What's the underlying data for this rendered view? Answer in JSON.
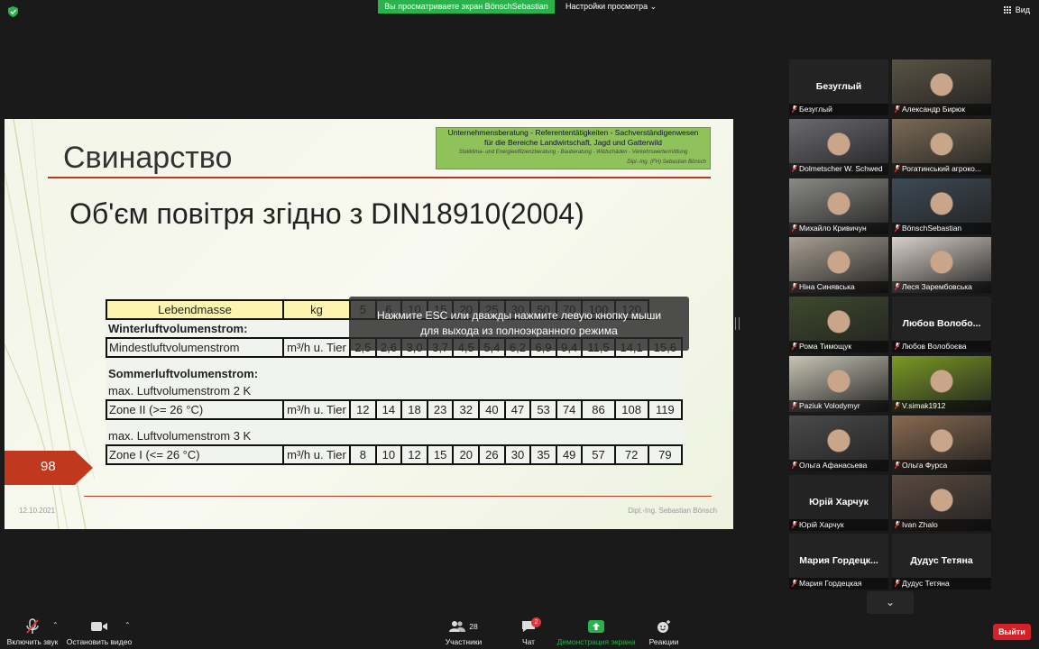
{
  "topbar": {
    "banner": "Вы просматриваете экран BönschSebastian",
    "view_options": "Настройки просмотра ⌄",
    "view": "Вид"
  },
  "slide": {
    "title": "Свинарство",
    "logo": {
      "line1": "Unternehmensberatung - Referententätigkeiten - Sachverständigenwesen",
      "line2": "für die Bereiche Landwirtschaft, Jagd und Gatterwild",
      "line3": "Stallklima- und Energieeffizienzberatung - Bauberatung - Wildschäden - Verkehrswertermittlung",
      "line4": "Dipl.-Ing. (FH) Sebastian Bönsch"
    },
    "subtitle": "Об'єм повітря згідно з DIN18910(2004)",
    "table": {
      "header": {
        "label": "Lebendmasse",
        "unit": "kg",
        "values": [
          "5",
          "6",
          "10",
          "15",
          "20",
          "25",
          "30",
          "50",
          "70",
          "100",
          "120"
        ]
      },
      "winter_title": "Winterluftvolumenstrom:",
      "min_row": {
        "label": "Mindestluftvolumenstrom",
        "unit": "m³/h u. Tier",
        "values": [
          "2,5",
          "2,6",
          "3,0",
          "3,7",
          "4,5",
          "5,4",
          "6,2",
          "6,9",
          "9,4",
          "11,5",
          "14,1",
          "15,6"
        ]
      },
      "summer_title": "Sommerluftvolumenstrom:",
      "max2_title": "max. Luftvolumenstrom 2 K",
      "zone2_row": {
        "label": "Zone II (>= 26 °C)",
        "unit": "m³/h u. Tier",
        "values": [
          "12",
          "14",
          "18",
          "23",
          "32",
          "40",
          "47",
          "53",
          "74",
          "86",
          "108",
          "119"
        ]
      },
      "max3_title": "max. Luftvolumenstrom 3 K",
      "zone1_row": {
        "label": "Zone I (<= 26 °C)",
        "unit": "m³/h u. Tier",
        "values": [
          "8",
          "10",
          "12",
          "15",
          "20",
          "26",
          "30",
          "35",
          "49",
          "57",
          "72",
          "79"
        ]
      }
    },
    "page_number": "98",
    "date": "12.10.2021",
    "author": "Dipl.-Ing. Sebastian Bönsch"
  },
  "esc_tooltip": {
    "line1": "Нажмите ESC или дважды нажмите левую кнопку мыши",
    "line2": "для выхода из полноэкранного режима"
  },
  "participants": [
    {
      "name": "Безуглый",
      "big": "Безуглый",
      "photo": false
    },
    {
      "name": "Александр Бирюк",
      "photo": true,
      "color": "#5a5244"
    },
    {
      "name": "Dolmetscher W. Schwed",
      "photo": true,
      "color": "#6b6a70",
      "active": true
    },
    {
      "name": "Рогатинський агроко...",
      "photo": true,
      "color": "#7a6a55"
    },
    {
      "name": "Михайло Кривичун",
      "photo": true,
      "color": "#8a8a86"
    },
    {
      "name": "BönschSebastian",
      "photo": true,
      "color": "#3d4a55"
    },
    {
      "name": "Ніна Синявська",
      "photo": true,
      "color": "#a89e92"
    },
    {
      "name": "Леся Зарембовська",
      "photo": true,
      "color": "#d8cfc8"
    },
    {
      "name": "Рома Тимощук",
      "photo": true,
      "color": "#3e4a2c"
    },
    {
      "name": "Любов Волобоєва",
      "big": "Любов  Волобо...",
      "photo": false
    },
    {
      "name": "Paziuk Volodymyr",
      "photo": true,
      "color": "#c8c4b4"
    },
    {
      "name": "V.simak1912",
      "photo": true,
      "color": "#7a9a22"
    },
    {
      "name": "Ольга Афанасьева",
      "photo": true,
      "color": "#4a4a4a"
    },
    {
      "name": "Ольга Фурса",
      "photo": true,
      "color": "#8a6a50"
    },
    {
      "name": "Юрій Харчук",
      "big": "Юрій Харчук",
      "photo": false
    },
    {
      "name": "Ivan Zhalo",
      "photo": true,
      "color": "#5a4a40"
    },
    {
      "name": "Мария Гордецкая",
      "big": "Мария  Гордецк...",
      "photo": false
    },
    {
      "name": "Дудус Тетяна",
      "big": "Дудус Тетяна",
      "photo": false
    }
  ],
  "toolbar": {
    "mute": "Включить звук",
    "video": "Остановить видео",
    "participants": "Участники",
    "participants_count": "28",
    "chat": "Чат",
    "chat_badge": "2",
    "share": "Демонстрация экрана",
    "reactions": "Реакции",
    "leave": "Выйти"
  },
  "colors": {
    "share_green": "#2bb24c",
    "leave_red": "#d42027",
    "active_outline": "#c7d600",
    "slide_accent": "#b33a25"
  }
}
